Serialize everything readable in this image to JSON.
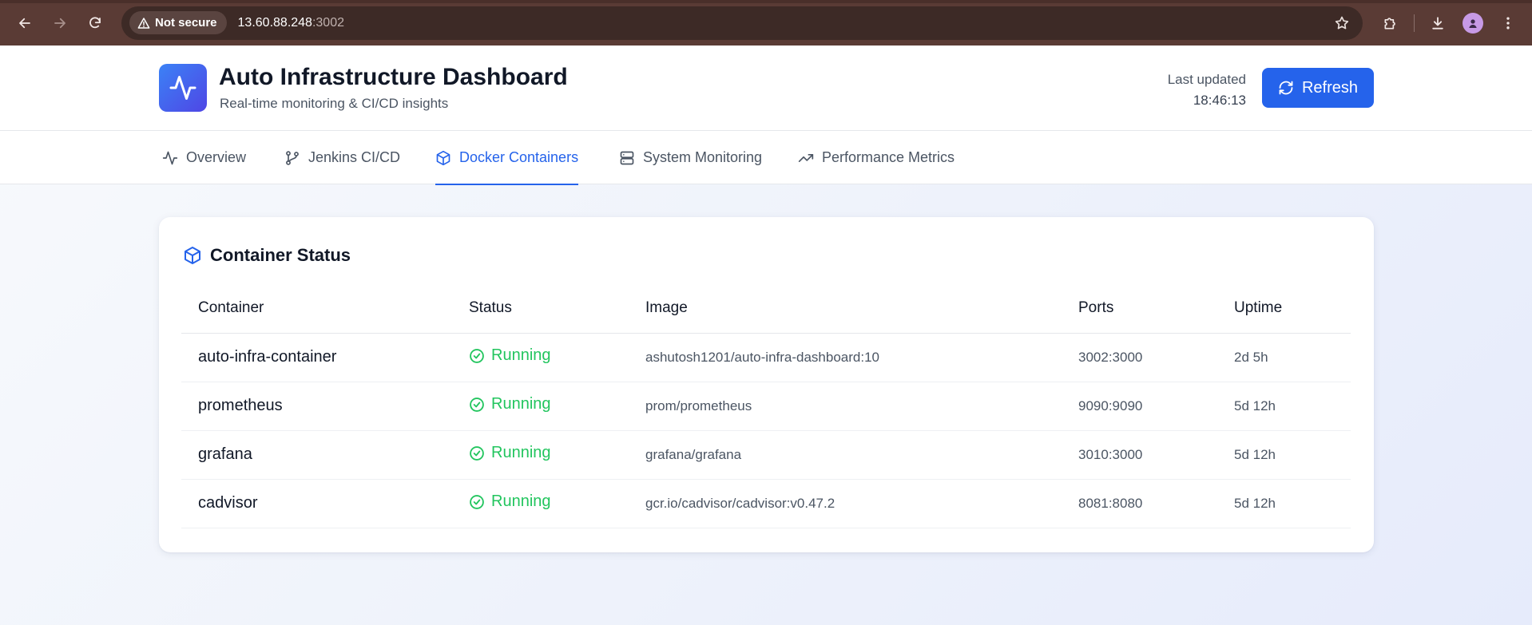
{
  "browser": {
    "security_label": "Not secure",
    "url_host": "13.60.88.248",
    "url_port": ":3002"
  },
  "header": {
    "title": "Auto Infrastructure Dashboard",
    "subtitle": "Real-time monitoring & CI/CD insights",
    "last_updated_label": "Last updated",
    "last_updated_time": "18:46:13",
    "refresh_label": "Refresh",
    "accent_color": "#2563eb"
  },
  "tabs": [
    {
      "label": "Overview",
      "icon": "activity-icon"
    },
    {
      "label": "Jenkins CI/CD",
      "icon": "git-branch-icon"
    },
    {
      "label": "Docker Containers",
      "icon": "container-icon",
      "active": true
    },
    {
      "label": "System Monitoring",
      "icon": "server-icon"
    },
    {
      "label": "Performance Metrics",
      "icon": "trending-up-icon"
    }
  ],
  "card": {
    "title": "Container Status",
    "columns": [
      "Container",
      "Status",
      "Image",
      "Ports",
      "Uptime"
    ],
    "rows": [
      {
        "name": "auto-infra-container",
        "status": "Running",
        "image": "ashutosh1201/auto-infra-dashboard:10",
        "ports": "3002:3000",
        "uptime": "2d 5h"
      },
      {
        "name": "prometheus",
        "status": "Running",
        "image": "prom/prometheus",
        "ports": "9090:9090",
        "uptime": "5d 12h"
      },
      {
        "name": "grafana",
        "status": "Running",
        "image": "grafana/grafana",
        "ports": "3010:3000",
        "uptime": "5d 12h"
      },
      {
        "name": "cadvisor",
        "status": "Running",
        "image": "gcr.io/cadvisor/cadvisor:v0.47.2",
        "ports": "8081:8080",
        "uptime": "5d 12h"
      }
    ],
    "status_color": "#22c55e"
  }
}
